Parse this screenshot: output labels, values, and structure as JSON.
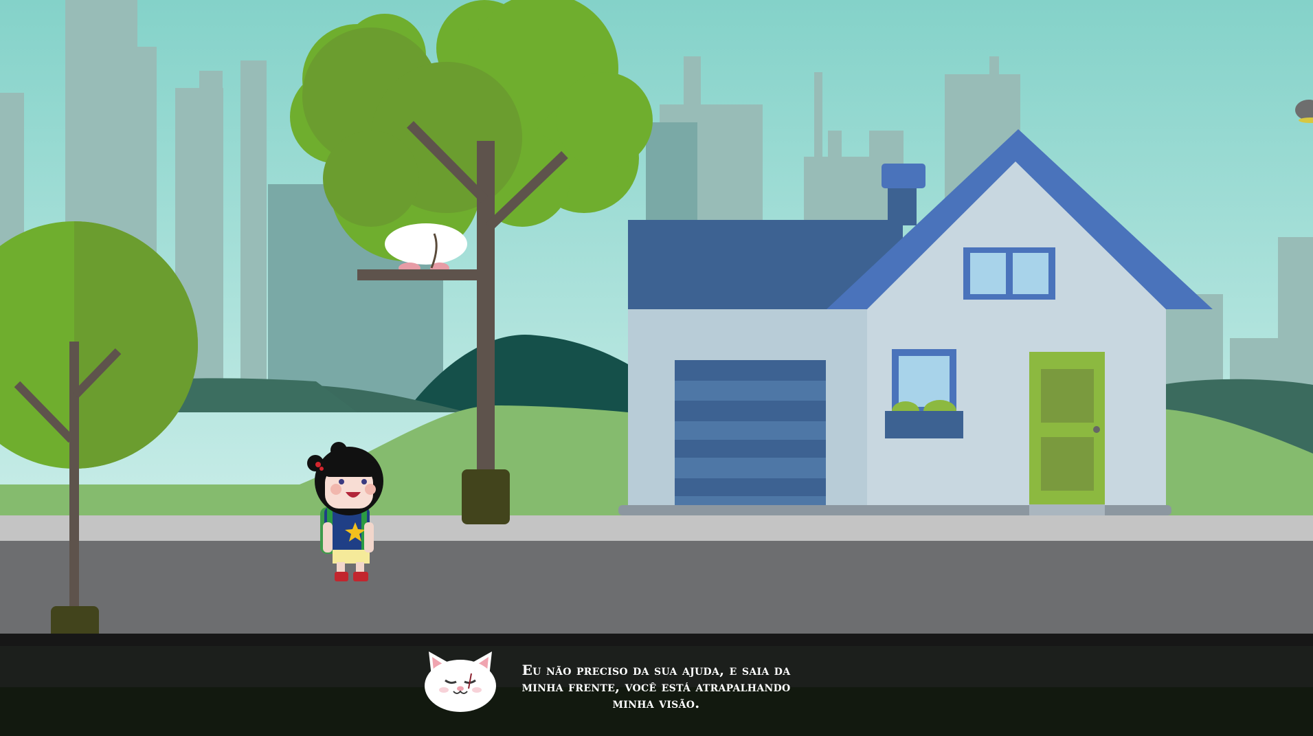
{
  "dialog": {
    "speaker_icon": "white-cat-face-icon",
    "text": "Eu não preciso da sua ajuda, e saia da minha frente, você está atrapalhando minha visão."
  },
  "colors": {
    "sky_top": "#84d2c9",
    "sky_bottom": "#c9ede8",
    "house_roof": "#4a73bb",
    "house_wall": "#c8d7e0",
    "door": "#8cb940",
    "tree_foliage": "#6fae2e",
    "road": "#6d6e70",
    "sidewalk": "#c4c4c4",
    "dialog_bg": "#1c1f1c"
  }
}
